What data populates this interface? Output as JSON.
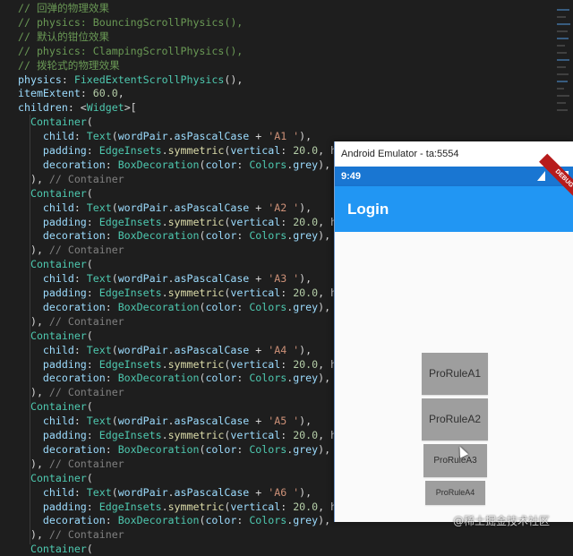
{
  "editor": {
    "lines": [
      [
        [
          "c",
          "// 回弹的物理效果"
        ]
      ],
      [
        [
          "c",
          "// physics: BouncingScrollPhysics(),"
        ]
      ],
      [
        [
          "c",
          "// 默认的钳位效果"
        ]
      ],
      [
        [
          "c",
          "// physics: ClampingScrollPhysics(),"
        ]
      ],
      [
        [
          "c",
          "// 拨轮式的物理效果"
        ]
      ],
      [
        [
          "k",
          "physics"
        ],
        [
          "p",
          ": "
        ],
        [
          "t",
          "FixedExtentScrollPhysics"
        ],
        [
          "p",
          "(),"
        ]
      ],
      [
        [
          "k",
          "itemExtent"
        ],
        [
          "p",
          ": "
        ],
        [
          "n",
          "60.0"
        ],
        [
          "p",
          ","
        ]
      ],
      [
        [
          "k",
          "children"
        ],
        [
          "p",
          ": <"
        ],
        [
          "t",
          "Widget"
        ],
        [
          "p",
          ">["
        ]
      ],
      [
        [
          "p",
          "  "
        ],
        [
          "t",
          "Container"
        ],
        [
          "p",
          "("
        ]
      ],
      [
        [
          "p",
          "    "
        ],
        [
          "k",
          "child"
        ],
        [
          "p",
          ": "
        ],
        [
          "t",
          "Text"
        ],
        [
          "p",
          "("
        ],
        [
          "k",
          "wordPair"
        ],
        [
          "p",
          "."
        ],
        [
          "k",
          "asPascalCase"
        ],
        [
          "p",
          " + "
        ],
        [
          "s",
          "'A1 '"
        ],
        [
          "p",
          "),"
        ]
      ],
      [
        [
          "p",
          "    "
        ],
        [
          "k",
          "padding"
        ],
        [
          "p",
          ": "
        ],
        [
          "t",
          "EdgeInsets"
        ],
        [
          "p",
          "."
        ],
        [
          "f",
          "symmetric"
        ],
        [
          "p",
          "("
        ],
        [
          "k",
          "vertical"
        ],
        [
          "p",
          ": "
        ],
        [
          "n",
          "20.0"
        ],
        [
          "p",
          ", horizo"
        ]
      ],
      [
        [
          "p",
          "    "
        ],
        [
          "k",
          "decoration"
        ],
        [
          "p",
          ": "
        ],
        [
          "t",
          "BoxDecoration"
        ],
        [
          "p",
          "("
        ],
        [
          "k",
          "color"
        ],
        [
          "p",
          ": "
        ],
        [
          "t",
          "Colors"
        ],
        [
          "p",
          "."
        ],
        [
          "k",
          "grey"
        ],
        [
          "p",
          "),"
        ]
      ],
      [
        [
          "p",
          "  ), "
        ],
        [
          "g",
          "// Container"
        ]
      ],
      [
        [
          "p",
          "  "
        ],
        [
          "t",
          "Container"
        ],
        [
          "p",
          "("
        ]
      ],
      [
        [
          "p",
          "    "
        ],
        [
          "k",
          "child"
        ],
        [
          "p",
          ": "
        ],
        [
          "t",
          "Text"
        ],
        [
          "p",
          "("
        ],
        [
          "k",
          "wordPair"
        ],
        [
          "p",
          "."
        ],
        [
          "k",
          "asPascalCase"
        ],
        [
          "p",
          " + "
        ],
        [
          "s",
          "'A2 '"
        ],
        [
          "p",
          "),"
        ]
      ],
      [
        [
          "p",
          "    "
        ],
        [
          "k",
          "padding"
        ],
        [
          "p",
          ": "
        ],
        [
          "t",
          "EdgeInsets"
        ],
        [
          "p",
          "."
        ],
        [
          "f",
          "symmetric"
        ],
        [
          "p",
          "("
        ],
        [
          "k",
          "vertical"
        ],
        [
          "p",
          ": "
        ],
        [
          "n",
          "20.0"
        ],
        [
          "p",
          ", horizo"
        ]
      ],
      [
        [
          "p",
          "    "
        ],
        [
          "k",
          "decoration"
        ],
        [
          "p",
          ": "
        ],
        [
          "t",
          "BoxDecoration"
        ],
        [
          "p",
          "("
        ],
        [
          "k",
          "color"
        ],
        [
          "p",
          ": "
        ],
        [
          "t",
          "Colors"
        ],
        [
          "p",
          "."
        ],
        [
          "k",
          "grey"
        ],
        [
          "p",
          "),"
        ]
      ],
      [
        [
          "p",
          "  ), "
        ],
        [
          "g",
          "// Container"
        ]
      ],
      [
        [
          "p",
          "  "
        ],
        [
          "t",
          "Container"
        ],
        [
          "p",
          "("
        ]
      ],
      [
        [
          "p",
          "    "
        ],
        [
          "k",
          "child"
        ],
        [
          "p",
          ": "
        ],
        [
          "t",
          "Text"
        ],
        [
          "p",
          "("
        ],
        [
          "k",
          "wordPair"
        ],
        [
          "p",
          "."
        ],
        [
          "k",
          "asPascalCase"
        ],
        [
          "p",
          " + "
        ],
        [
          "s",
          "'A3 '"
        ],
        [
          "p",
          "),"
        ]
      ],
      [
        [
          "p",
          "    "
        ],
        [
          "k",
          "padding"
        ],
        [
          "p",
          ": "
        ],
        [
          "t",
          "EdgeInsets"
        ],
        [
          "p",
          "."
        ],
        [
          "f",
          "symmetric"
        ],
        [
          "p",
          "("
        ],
        [
          "k",
          "vertical"
        ],
        [
          "p",
          ": "
        ],
        [
          "n",
          "20.0"
        ],
        [
          "p",
          ", horizo"
        ]
      ],
      [
        [
          "p",
          "    "
        ],
        [
          "k",
          "decoration"
        ],
        [
          "p",
          ": "
        ],
        [
          "t",
          "BoxDecoration"
        ],
        [
          "p",
          "("
        ],
        [
          "k",
          "color"
        ],
        [
          "p",
          ": "
        ],
        [
          "t",
          "Colors"
        ],
        [
          "p",
          "."
        ],
        [
          "k",
          "grey"
        ],
        [
          "p",
          "),"
        ]
      ],
      [
        [
          "p",
          "  ), "
        ],
        [
          "g",
          "// Container"
        ]
      ],
      [
        [
          "p",
          "  "
        ],
        [
          "t",
          "Container"
        ],
        [
          "p",
          "("
        ]
      ],
      [
        [
          "p",
          "    "
        ],
        [
          "k",
          "child"
        ],
        [
          "p",
          ": "
        ],
        [
          "t",
          "Text"
        ],
        [
          "p",
          "("
        ],
        [
          "k",
          "wordPair"
        ],
        [
          "p",
          "."
        ],
        [
          "k",
          "asPascalCase"
        ],
        [
          "p",
          " + "
        ],
        [
          "s",
          "'A4 '"
        ],
        [
          "p",
          "),"
        ]
      ],
      [
        [
          "p",
          "    "
        ],
        [
          "k",
          "padding"
        ],
        [
          "p",
          ": "
        ],
        [
          "t",
          "EdgeInsets"
        ],
        [
          "p",
          "."
        ],
        [
          "f",
          "symmetric"
        ],
        [
          "p",
          "("
        ],
        [
          "k",
          "vertical"
        ],
        [
          "p",
          ": "
        ],
        [
          "n",
          "20.0"
        ],
        [
          "p",
          ", horizo"
        ]
      ],
      [
        [
          "p",
          "    "
        ],
        [
          "k",
          "decoration"
        ],
        [
          "p",
          ": "
        ],
        [
          "t",
          "BoxDecoration"
        ],
        [
          "p",
          "("
        ],
        [
          "k",
          "color"
        ],
        [
          "p",
          ": "
        ],
        [
          "t",
          "Colors"
        ],
        [
          "p",
          "."
        ],
        [
          "k",
          "grey"
        ],
        [
          "p",
          "),"
        ]
      ],
      [
        [
          "p",
          "  ), "
        ],
        [
          "g",
          "// Container"
        ]
      ],
      [
        [
          "p",
          "  "
        ],
        [
          "t",
          "Container"
        ],
        [
          "p",
          "("
        ]
      ],
      [
        [
          "p",
          "    "
        ],
        [
          "k",
          "child"
        ],
        [
          "p",
          ": "
        ],
        [
          "t",
          "Text"
        ],
        [
          "p",
          "("
        ],
        [
          "k",
          "wordPair"
        ],
        [
          "p",
          "."
        ],
        [
          "k",
          "asPascalCase"
        ],
        [
          "p",
          " + "
        ],
        [
          "s",
          "'A5 '"
        ],
        [
          "p",
          "),"
        ]
      ],
      [
        [
          "p",
          "    "
        ],
        [
          "k",
          "padding"
        ],
        [
          "p",
          ": "
        ],
        [
          "t",
          "EdgeInsets"
        ],
        [
          "p",
          "."
        ],
        [
          "f",
          "symmetric"
        ],
        [
          "p",
          "("
        ],
        [
          "k",
          "vertical"
        ],
        [
          "p",
          ": "
        ],
        [
          "n",
          "20.0"
        ],
        [
          "p",
          ", horizo"
        ]
      ],
      [
        [
          "p",
          "    "
        ],
        [
          "k",
          "decoration"
        ],
        [
          "p",
          ": "
        ],
        [
          "t",
          "BoxDecoration"
        ],
        [
          "p",
          "("
        ],
        [
          "k",
          "color"
        ],
        [
          "p",
          ": "
        ],
        [
          "t",
          "Colors"
        ],
        [
          "p",
          "."
        ],
        [
          "k",
          "grey"
        ],
        [
          "p",
          "),"
        ]
      ],
      [
        [
          "p",
          "  ), "
        ],
        [
          "g",
          "// Container"
        ]
      ],
      [
        [
          "p",
          "  "
        ],
        [
          "t",
          "Container"
        ],
        [
          "p",
          "("
        ]
      ],
      [
        [
          "p",
          "    "
        ],
        [
          "k",
          "child"
        ],
        [
          "p",
          ": "
        ],
        [
          "t",
          "Text"
        ],
        [
          "p",
          "("
        ],
        [
          "k",
          "wordPair"
        ],
        [
          "p",
          "."
        ],
        [
          "k",
          "asPascalCase"
        ],
        [
          "p",
          " + "
        ],
        [
          "s",
          "'A6 '"
        ],
        [
          "p",
          "),"
        ]
      ],
      [
        [
          "p",
          "    "
        ],
        [
          "k",
          "padding"
        ],
        [
          "p",
          ": "
        ],
        [
          "t",
          "EdgeInsets"
        ],
        [
          "p",
          "."
        ],
        [
          "f",
          "symmetric"
        ],
        [
          "p",
          "("
        ],
        [
          "k",
          "vertical"
        ],
        [
          "p",
          ": "
        ],
        [
          "n",
          "20.0"
        ],
        [
          "p",
          ", horizo"
        ]
      ],
      [
        [
          "p",
          "    "
        ],
        [
          "k",
          "decoration"
        ],
        [
          "p",
          ": "
        ],
        [
          "t",
          "BoxDecoration"
        ],
        [
          "p",
          "("
        ],
        [
          "k",
          "color"
        ],
        [
          "p",
          ": "
        ],
        [
          "t",
          "Colors"
        ],
        [
          "p",
          "."
        ],
        [
          "k",
          "grey"
        ],
        [
          "p",
          "),"
        ]
      ],
      [
        [
          "p",
          "  ), "
        ],
        [
          "g",
          "// Container"
        ]
      ],
      [
        [
          "p",
          "  "
        ],
        [
          "t",
          "Container"
        ],
        [
          "p",
          "("
        ]
      ]
    ]
  },
  "emulator": {
    "window_title": "Android Emulator - ta:5554",
    "status_time": "9:49",
    "debug_banner": "DEBUG",
    "app_title": "Login",
    "items": [
      "ProRuleA1",
      "ProRuleA2",
      "ProRuleA3",
      "ProRuleA4"
    ]
  },
  "watermark": "@稀土掘金技术社区"
}
